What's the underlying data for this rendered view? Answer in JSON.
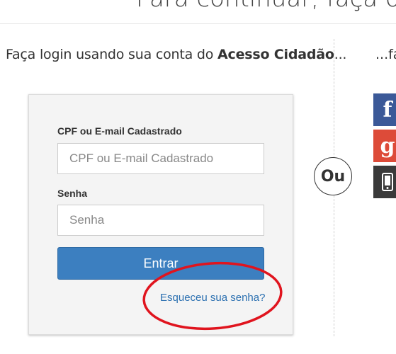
{
  "header": {
    "title": "Para continuar, faça o"
  },
  "intro": {
    "prefix": "Faça login usando sua conta do ",
    "brand": "Acesso Cidadão",
    "suffix": "..."
  },
  "right_intro": "...fa",
  "separator": {
    "label": "Ou"
  },
  "login_form": {
    "cpf": {
      "label": "CPF ou E-mail Cadastrado",
      "placeholder": "CPF ou E-mail Cadastrado",
      "value": ""
    },
    "password": {
      "label": "Senha",
      "placeholder": "Senha",
      "value": ""
    },
    "submit_label": "Entrar",
    "forgot_label": "Esqueceu sua senha?"
  },
  "social_buttons": [
    {
      "icon": "facebook-icon",
      "glyph": "f",
      "color": "#3b5998"
    },
    {
      "icon": "google-plus-icon",
      "glyph": "g",
      "color": "#dd4b39"
    },
    {
      "icon": "mobile-phone-icon",
      "color": "#3a3a3a"
    }
  ],
  "annotation": {
    "color": "#e0141e"
  }
}
